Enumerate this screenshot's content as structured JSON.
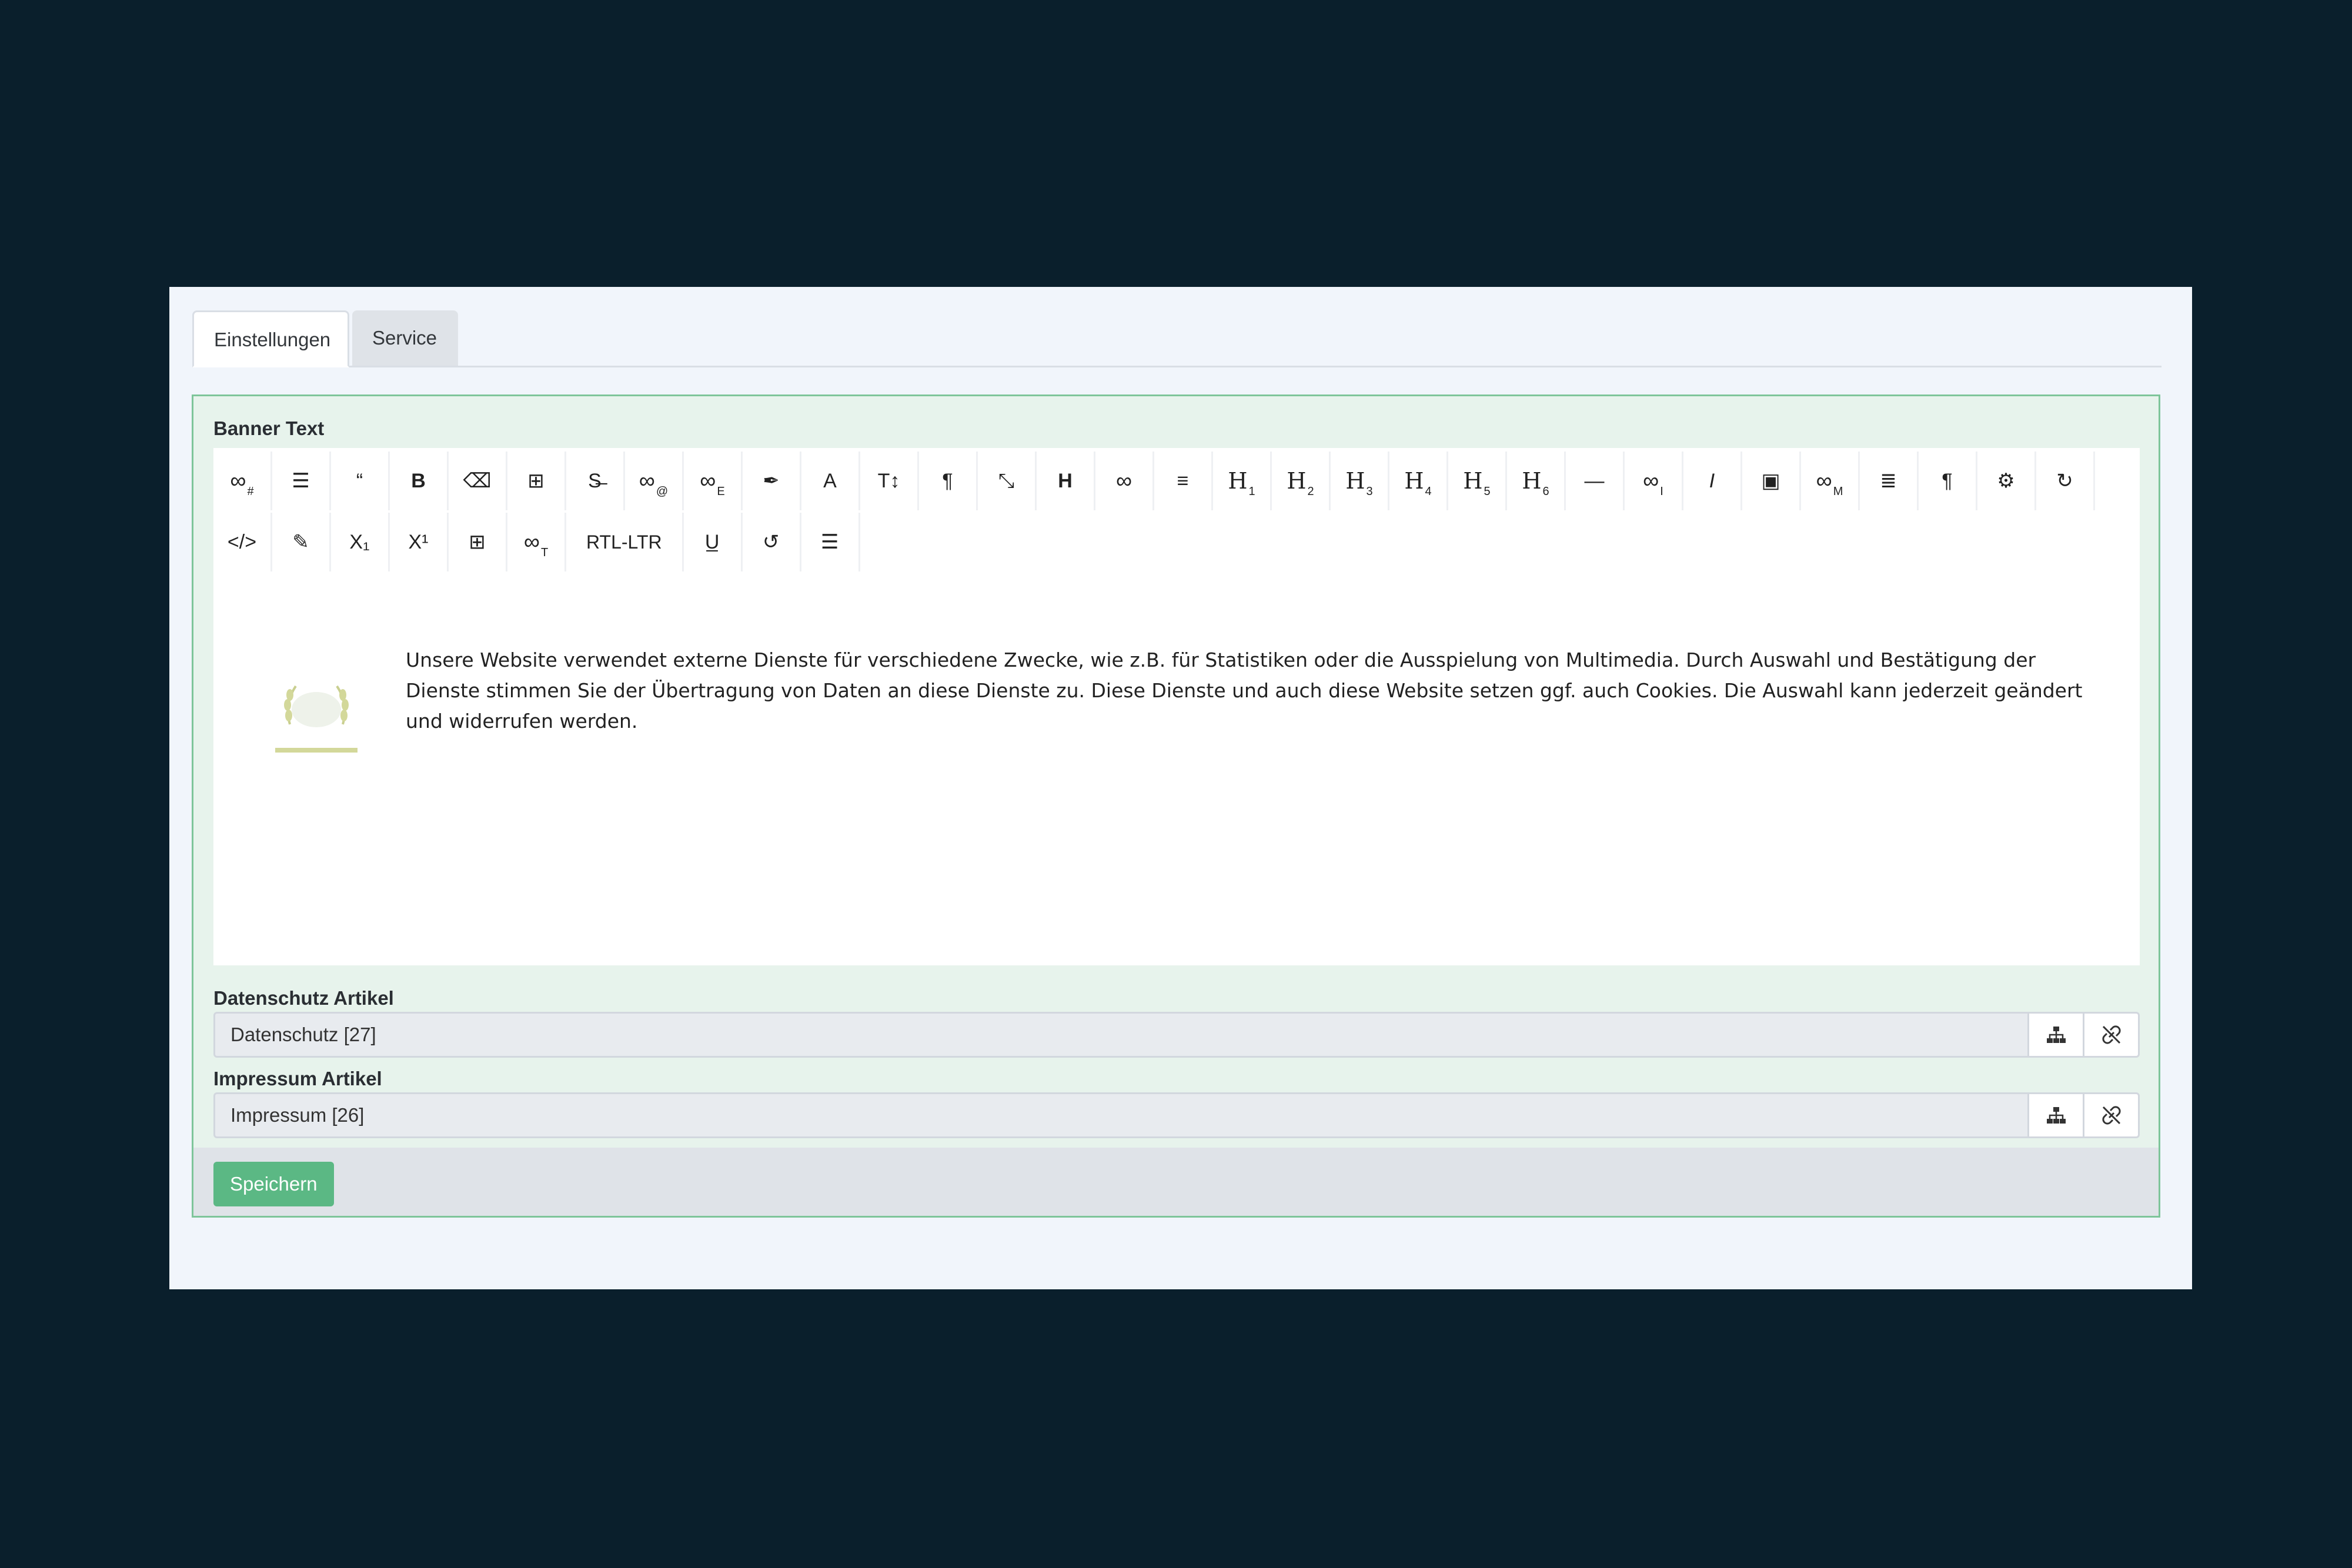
{
  "tabs": [
    {
      "label": "Einstellungen",
      "active": true
    },
    {
      "label": "Service",
      "active": false
    }
  ],
  "banner": {
    "label": "Banner Text",
    "toolbar_row1": [
      {
        "icon": "link-anchor-icon",
        "sub": "#"
      },
      {
        "icon": "align-left-icon"
      },
      {
        "icon": "quote-icon"
      },
      {
        "icon": "bold-icon"
      },
      {
        "icon": "eraser-icon"
      },
      {
        "icon": "table-icon"
      },
      {
        "icon": "strikethrough-icon"
      },
      {
        "icon": "link-email-icon",
        "sub": "@"
      },
      {
        "icon": "link-external-icon",
        "sub": "E"
      },
      {
        "icon": "brush-icon"
      },
      {
        "icon": "font-color-icon"
      },
      {
        "icon": "font-size-icon"
      },
      {
        "icon": "paragraph-icon"
      },
      {
        "icon": "fullscreen-icon"
      },
      {
        "icon": "heading-icon"
      },
      {
        "icon": "link-icon"
      },
      {
        "icon": "bullet-list-icon"
      },
      {
        "icon": "h1-icon",
        "h": "H",
        "sub": "1"
      },
      {
        "icon": "h2-icon",
        "h": "H",
        "sub": "2"
      },
      {
        "icon": "h3-icon",
        "h": "H",
        "sub": "3"
      },
      {
        "icon": "h4-icon",
        "h": "H",
        "sub": "4"
      },
      {
        "icon": "h5-icon",
        "h": "H",
        "sub": "5"
      },
      {
        "icon": "h6-icon",
        "h": "H",
        "sub": "6"
      },
      {
        "icon": "horizontal-rule-icon"
      },
      {
        "icon": "link-internal-icon",
        "sub": "I"
      },
      {
        "icon": "italic-icon"
      },
      {
        "icon": "image-icon"
      },
      {
        "icon": "link-media-icon",
        "sub": "M"
      },
      {
        "icon": "ordered-list-icon"
      },
      {
        "icon": "pilcrow-icon"
      },
      {
        "icon": "gear-icon"
      },
      {
        "icon": "redo-icon"
      }
    ],
    "toolbar_row2": [
      {
        "icon": "code-icon"
      },
      {
        "icon": "edit-icon"
      },
      {
        "icon": "subscript-icon"
      },
      {
        "icon": "superscript-icon"
      },
      {
        "icon": "table-icon"
      },
      {
        "icon": "link-tel-icon",
        "sub": "T"
      },
      {
        "icon": "rtl-ltr-button",
        "text": "RTL-LTR"
      },
      {
        "icon": "underline-icon"
      },
      {
        "icon": "undo-icon"
      },
      {
        "icon": "list-icon"
      }
    ],
    "content": "Unsere Website verwendet externe Dienste für verschiedene Zwecke, wie z.B. für Statistiken oder die Ausspielung von Multimedia. Durch Auswahl und Bestätigung der Dienste stimmen Sie der Übertragung von Daten an diese Dienste zu. Diese Dienste und auch diese Website setzen ggf. auch Cookies. Die Auswahl kann jederzeit geändert und widerrufen werden."
  },
  "privacy": {
    "label": "Datenschutz Artikel",
    "value": "Datenschutz [27]"
  },
  "imprint": {
    "label": "Impressum Artikel",
    "value": "Impressum [26]"
  },
  "save_label": "Speichern",
  "colors": {
    "background": "#0a1f2c",
    "panel_border": "#7ec59a",
    "save_button": "#5bb884"
  }
}
